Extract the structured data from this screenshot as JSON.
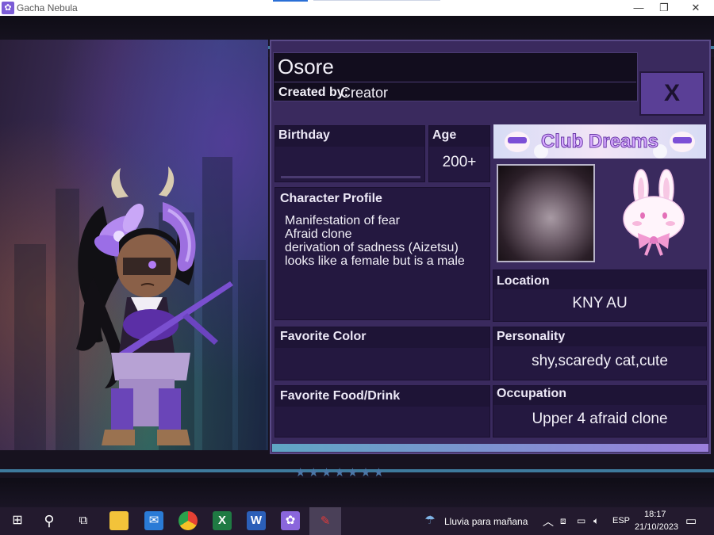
{
  "window": {
    "title": "Gacha Nebula",
    "minimize_glyph": "—",
    "restore_glyph": "❐",
    "close_glyph": "✕"
  },
  "decor": {
    "stars": "★★★★★★★"
  },
  "profile": {
    "name": "Osore",
    "created_by_label": "Created by:",
    "creator": "Creator",
    "close_label": "X",
    "birthday_label": "Birthday",
    "birthday_value": "",
    "age_label": "Age",
    "age_value": "200+",
    "profile_label": "Character Profile",
    "profile_text": "Manifestation of fear\nAfraid clone\nderivation of sadness (Aizetsu)\nlooks like a female but is a male",
    "favorite_color_label": "Favorite Color",
    "favorite_color_value": "",
    "favorite_food_label": "Favorite Food/Drink",
    "favorite_food_value": "",
    "location_label": "Location",
    "location_value": "KNY AU",
    "personality_label": "Personality",
    "personality_value": "shy,scaredy cat,cute",
    "occupation_label": "Occupation",
    "occupation_value": "Upper 4 afraid clone",
    "banner_text": "Club Dreams"
  },
  "taskbar": {
    "weather": "Lluvia para mañana",
    "language": "ESP",
    "time": "18:17",
    "date": "21/10/2023",
    "icons": [
      "windows-start-icon",
      "search-icon",
      "task-view-icon",
      "file-explorer-icon",
      "mail-icon",
      "chrome-icon",
      "excel-icon",
      "word-icon",
      "gacha-nebula-icon",
      "paint-icon"
    ]
  },
  "colors": {
    "panel": "#3a2a5e",
    "accent": "#5a3f96",
    "stripe": "#3e7a9c",
    "taskbar": "#231a2e"
  }
}
